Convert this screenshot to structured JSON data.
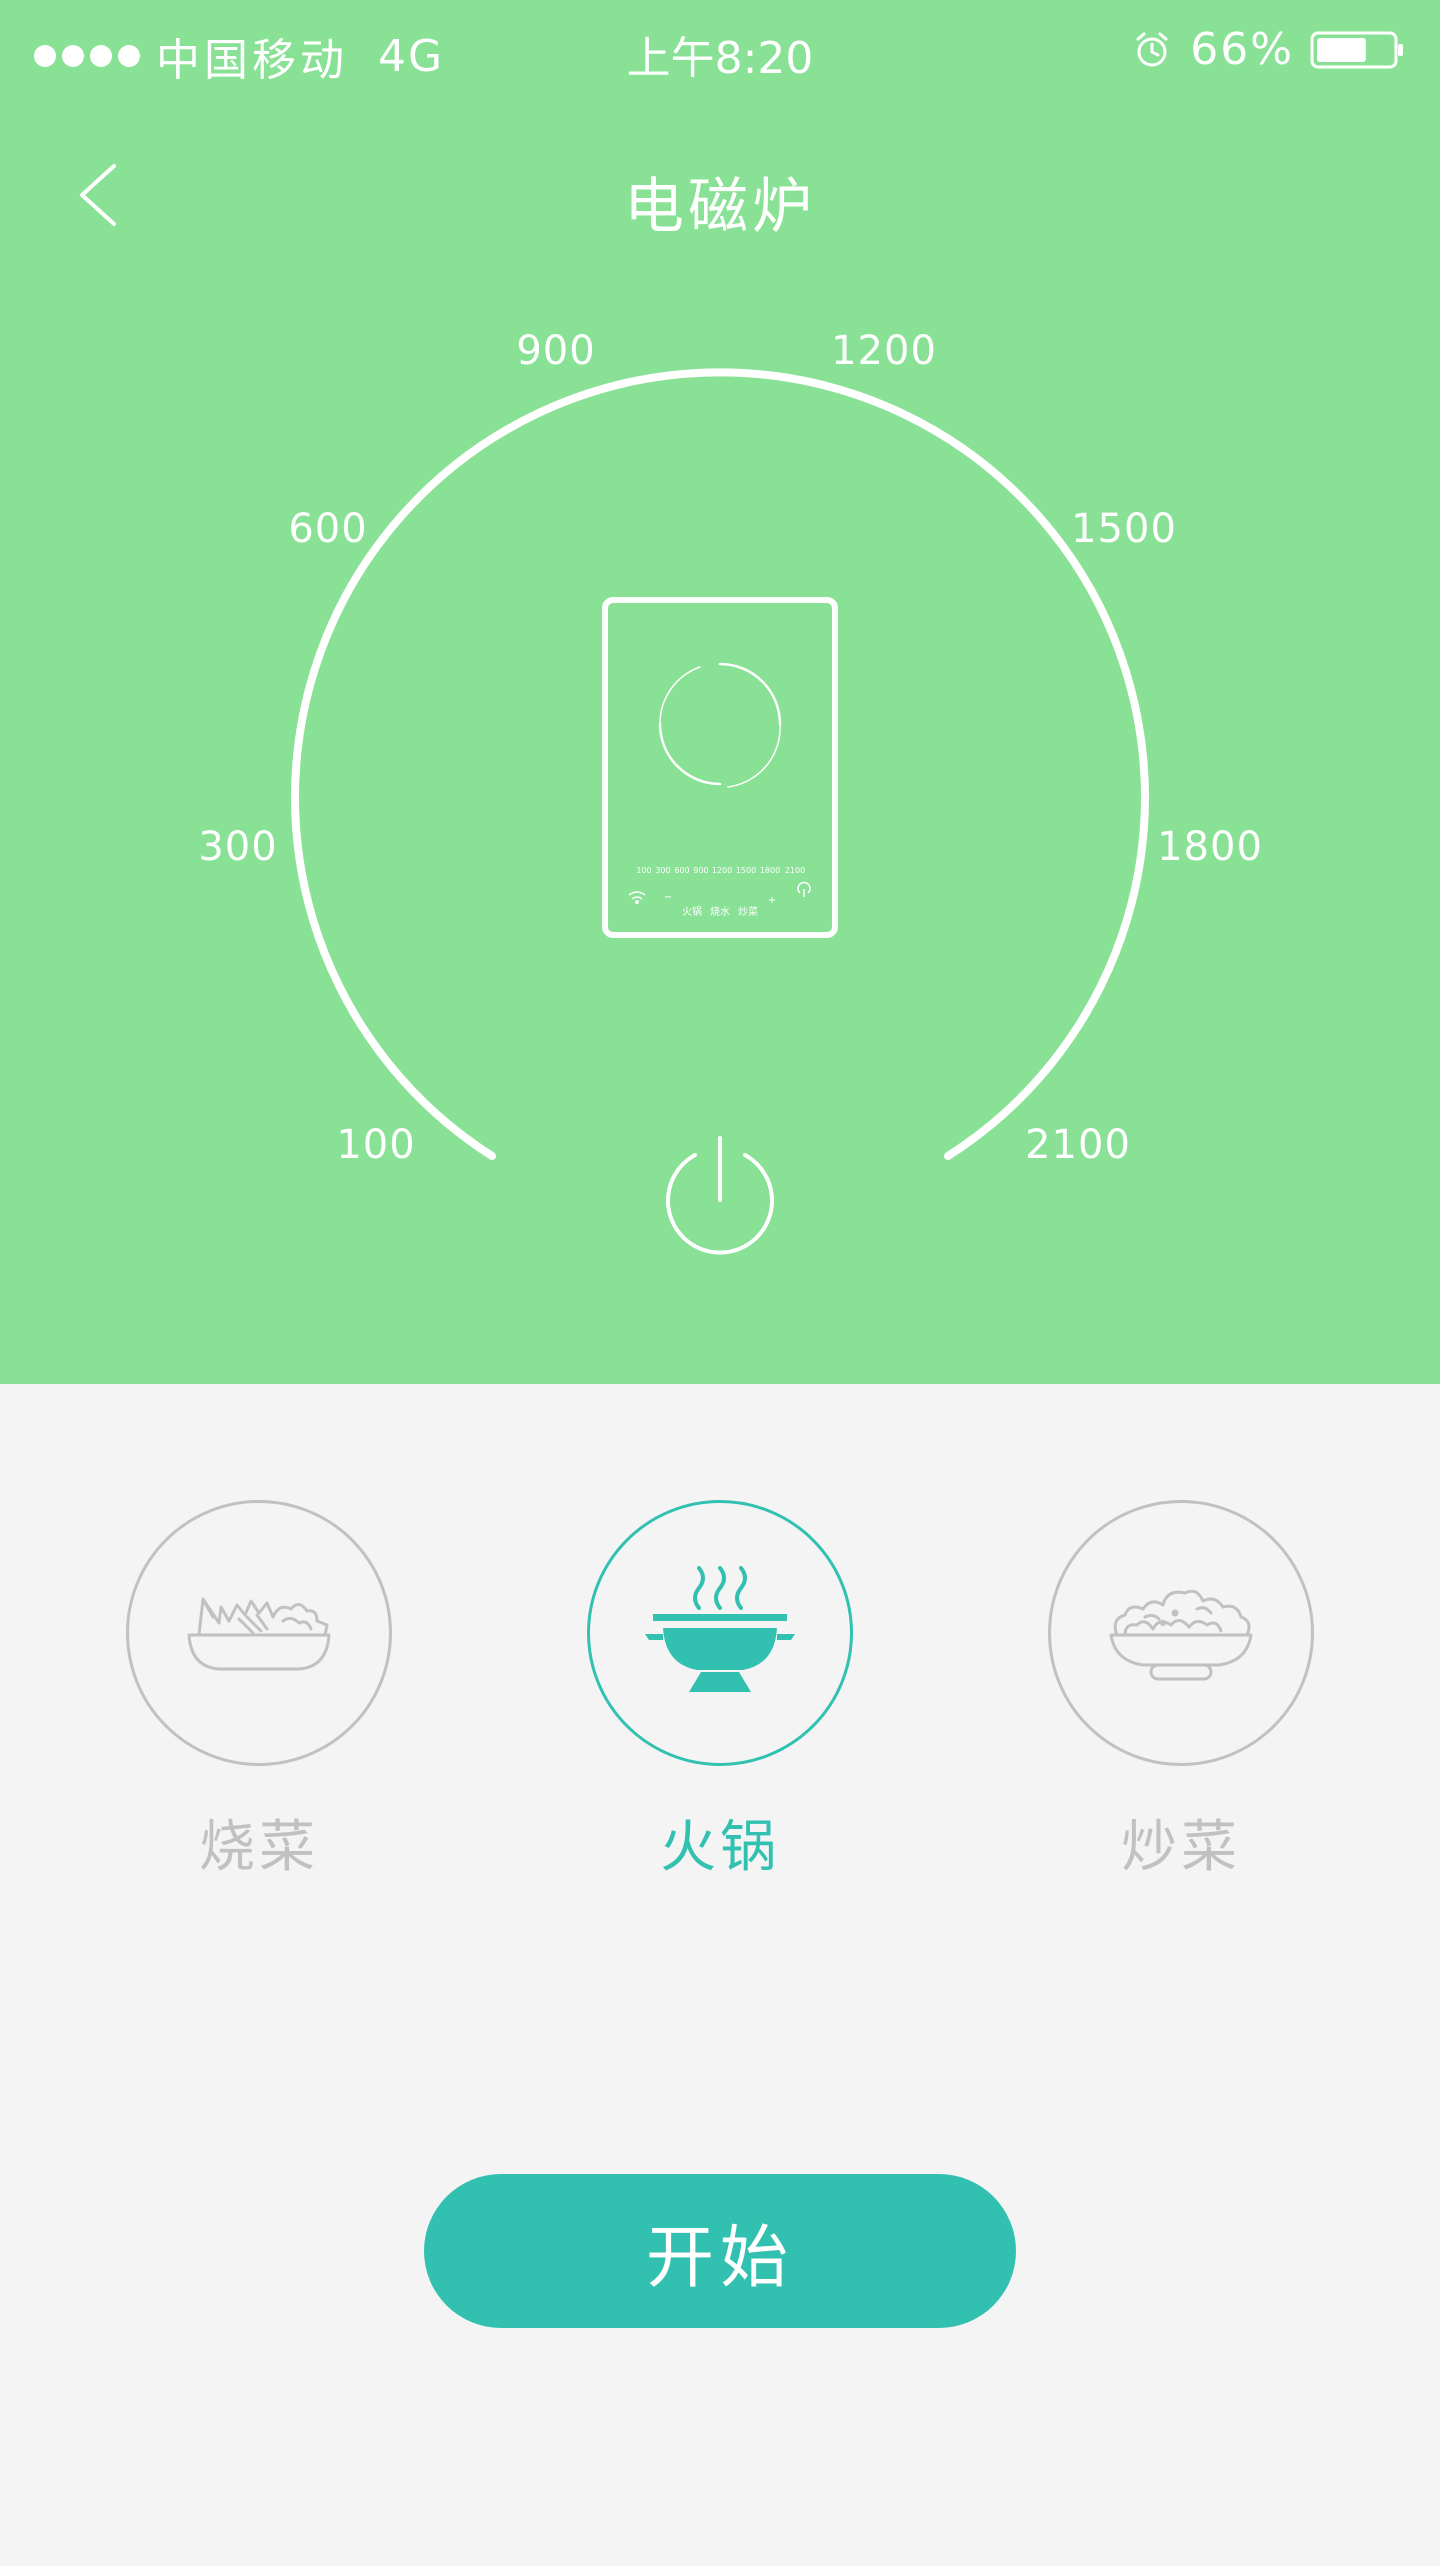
{
  "status_bar": {
    "carrier": "中国移动",
    "network": "4G",
    "time": "上午8:20",
    "battery_percent": "66%",
    "battery_level": 0.66,
    "signal_dots": 4,
    "icons": [
      "signal-dots-icon",
      "alarm-icon",
      "battery-icon"
    ]
  },
  "header": {
    "title": "电磁炉",
    "back_icon": "chevron-left-icon"
  },
  "dial": {
    "ticks": [
      "100",
      "300",
      "600",
      "900",
      "1200",
      "1500",
      "1800",
      "2100"
    ],
    "device_scale": [
      "100",
      "300",
      "600",
      "900",
      "1200",
      "1500",
      "1800",
      "2100"
    ],
    "device_labels": [
      "火锅",
      "烧水",
      "炒菜"
    ],
    "device_minus": "−",
    "device_plus": "+",
    "power_icon": "power-icon"
  },
  "modes": [
    {
      "label": "烧菜",
      "icon": "salad-bowl-icon",
      "active": false
    },
    {
      "label": "火锅",
      "icon": "hotpot-icon",
      "active": true
    },
    {
      "label": "炒菜",
      "icon": "stir-fry-bowl-icon",
      "active": false
    }
  ],
  "start_button": {
    "label": "开始"
  },
  "colors": {
    "top_background": "#88e195",
    "page_background": "#f4f4f4",
    "accent": "#32c1b1",
    "inactive": "#c1c1c1",
    "on_green": "#ffffff"
  }
}
